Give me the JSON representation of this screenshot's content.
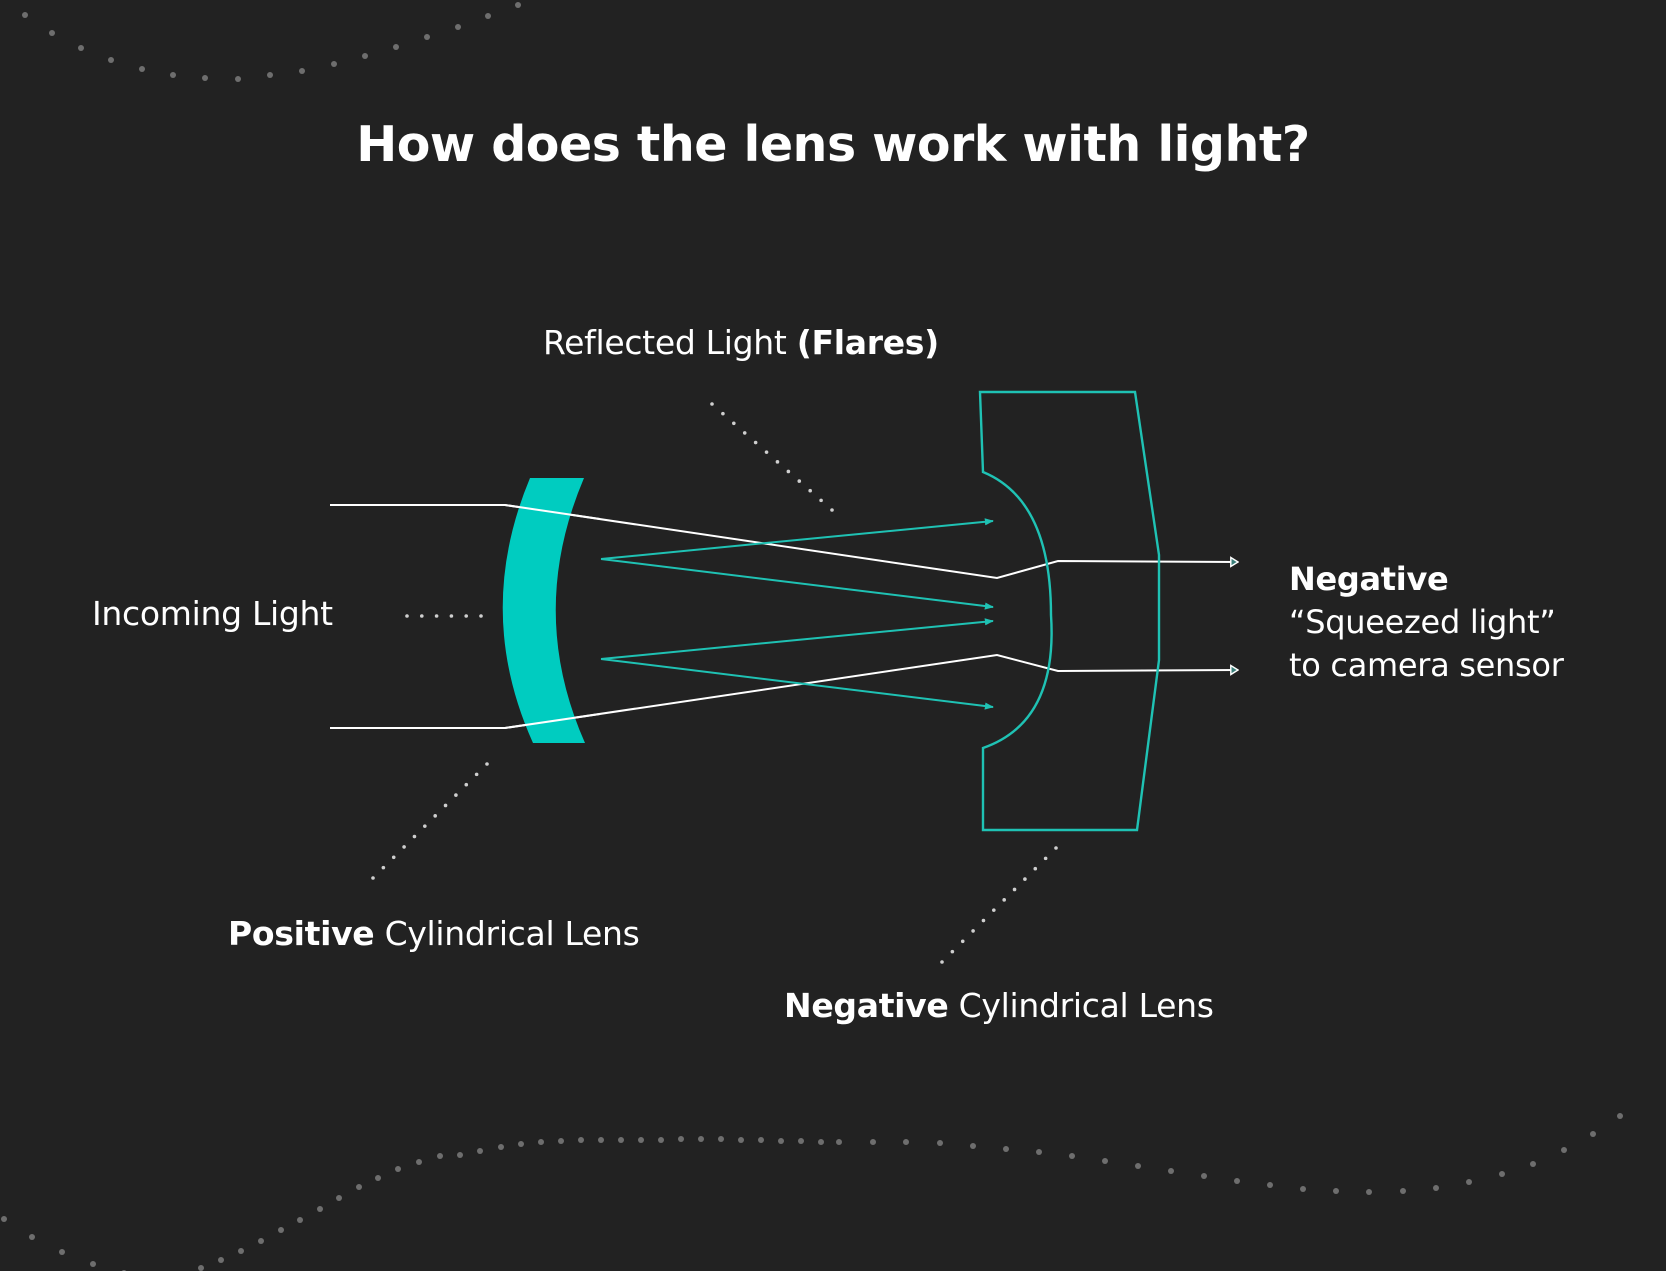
{
  "title": "How does the lens work with light?",
  "colors": {
    "background": "#222222",
    "lens_fill": "#00CCC0",
    "lens_outline": "#1FC2B4",
    "light_ray": "#FFFFFF",
    "reflected_ray": "#1FC2B4",
    "decor_dots": "#6E6E6E",
    "leader_dots": "#CFCFCF"
  },
  "labels": {
    "reflected": {
      "regular": "Reflected Light ",
      "bold": "(Flares)"
    },
    "incoming": {
      "regular": "Incoming Light"
    },
    "positive_lens": {
      "bold": "Positive",
      "regular": " Cylindrical Lens"
    },
    "negative_lens": {
      "bold": "Negative",
      "regular": " Cylindrical Lens"
    },
    "output": {
      "bold": "Negative",
      "line2": "“Squeezed light”",
      "line3": "to camera sensor"
    }
  },
  "diagram": {
    "elements": [
      {
        "id": "incoming-rays",
        "type": "light-ray",
        "count": 2
      },
      {
        "id": "positive-cylindrical-lens",
        "type": "lens",
        "kind": "positive"
      },
      {
        "id": "reflected-rays",
        "type": "reflected-ray",
        "count": 4
      },
      {
        "id": "negative-cylindrical-lens",
        "type": "lens",
        "kind": "negative"
      },
      {
        "id": "output-rays",
        "type": "light-ray",
        "count": 2
      }
    ]
  }
}
